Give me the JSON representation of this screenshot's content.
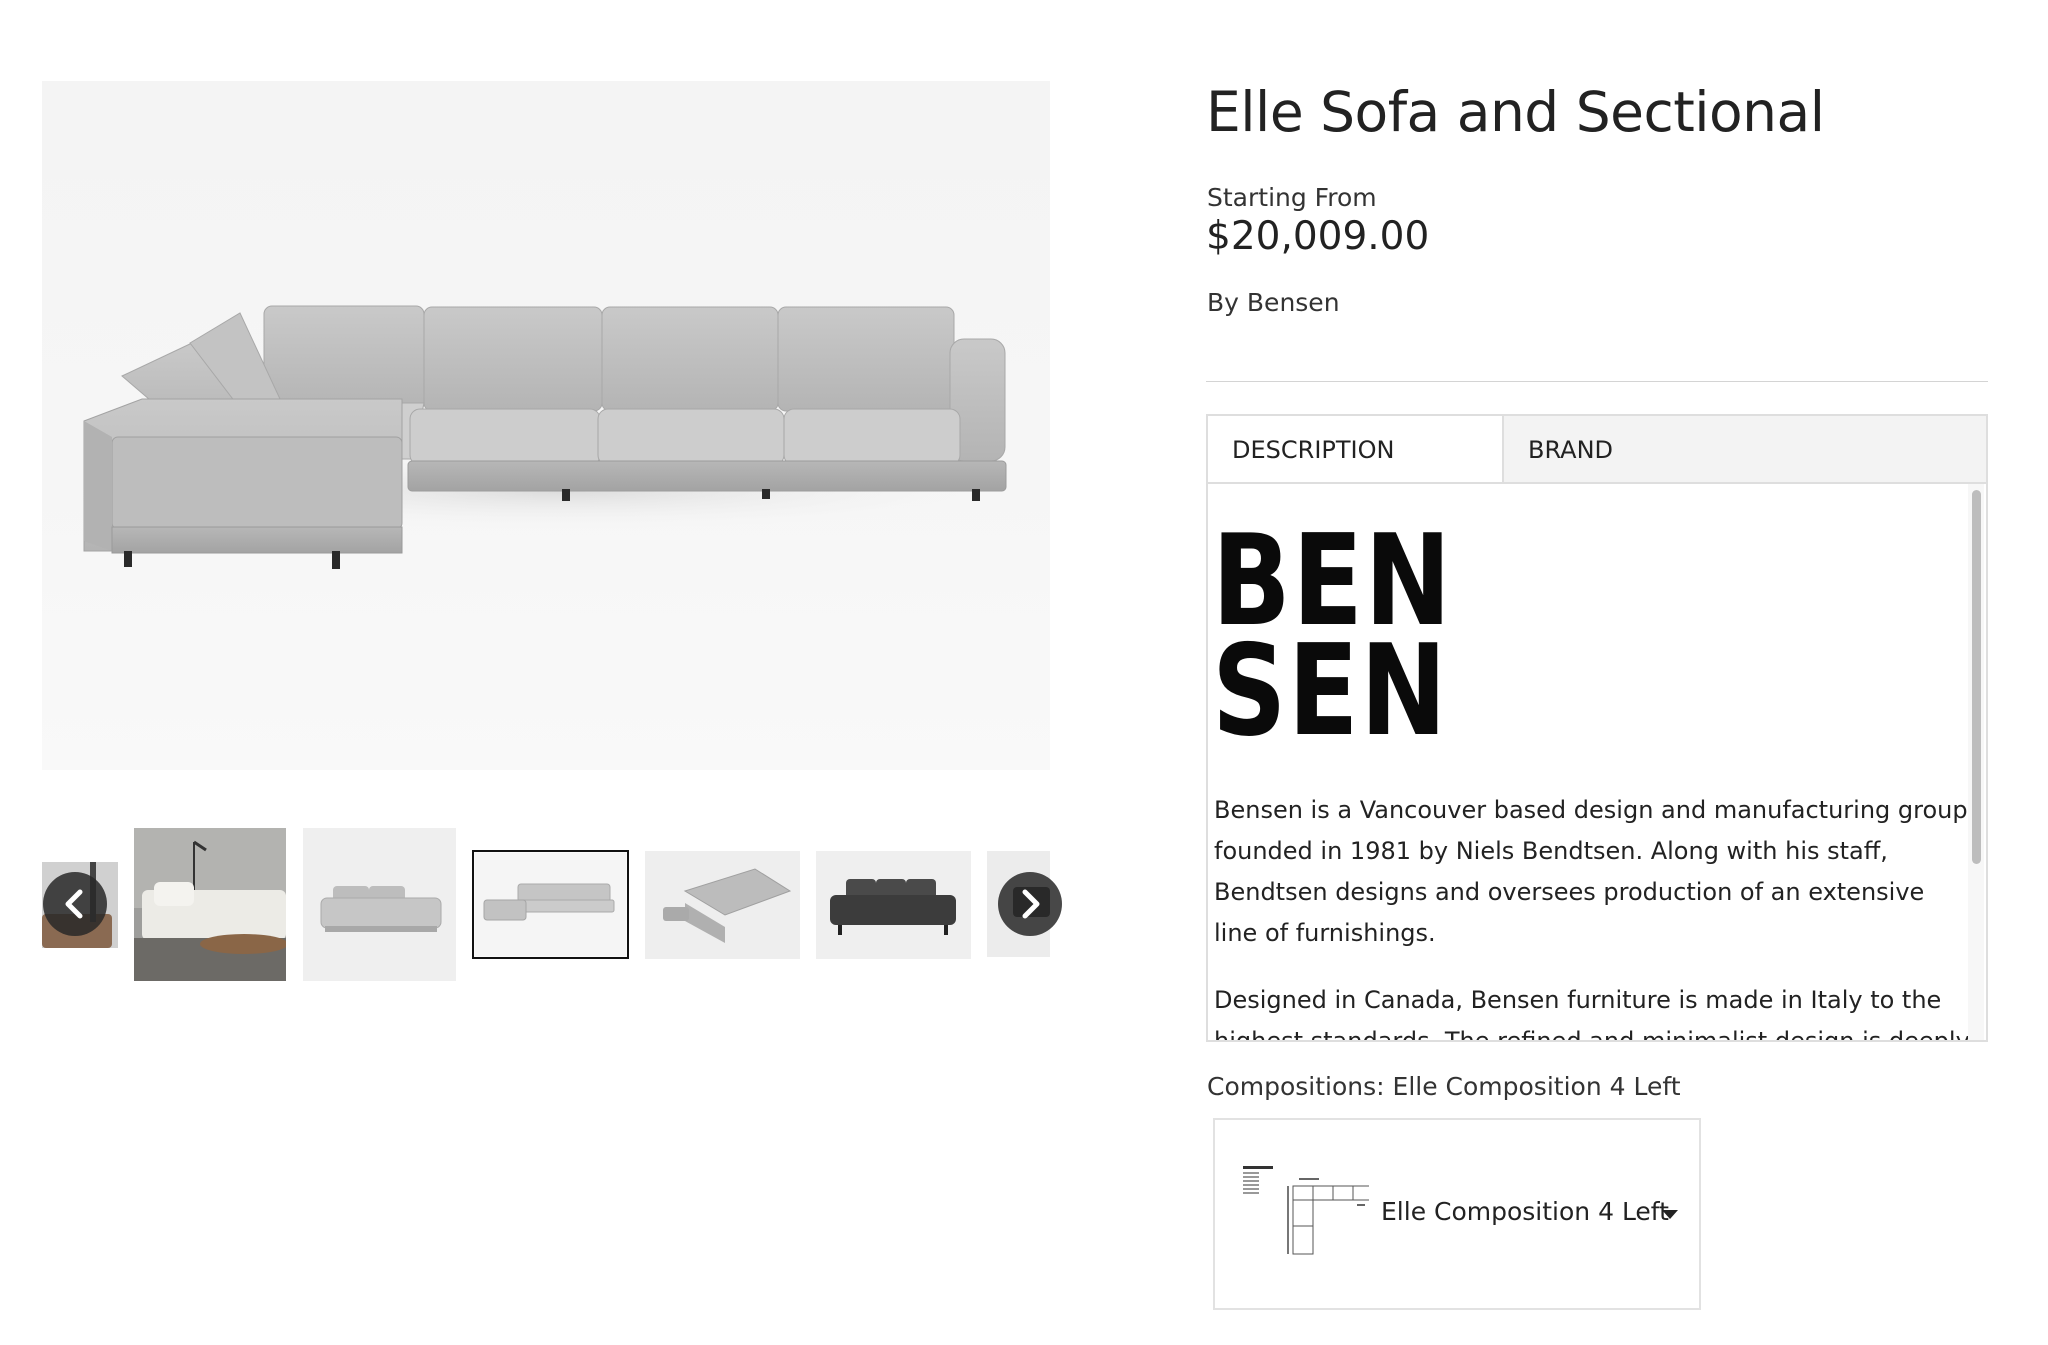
{
  "product": {
    "title": "Elle Sofa and Sectional",
    "price_prefix": "Starting From",
    "price": "$20,009.00",
    "by_prefix": "By",
    "brand": "Bensen"
  },
  "gallery": {
    "main_image": "sectional-sofa-photo",
    "thumbnails": [
      {
        "name": "partial-photo",
        "selected": false
      },
      {
        "name": "living-room-sectional-photo",
        "selected": false
      },
      {
        "name": "grey-sofa-photo",
        "selected": false
      },
      {
        "name": "l-sectional-photo",
        "selected": true
      },
      {
        "name": "sectional-with-ottoman-photo",
        "selected": false
      },
      {
        "name": "dark-grey-sofa-photo",
        "selected": false
      },
      {
        "name": "partial-dark-photo",
        "selected": false
      }
    ],
    "prev_icon": "chevron-left-icon",
    "next_icon": "chevron-right-icon"
  },
  "tabs": [
    {
      "label": "DESCRIPTION",
      "active": false
    },
    {
      "label": "BRAND",
      "active": true
    }
  ],
  "brand_panel": {
    "logo_line1": "BEN",
    "logo_line2": "SEN",
    "paragraphs": [
      "Bensen is a Vancouver based design and manufacturing group founded in 1981 by Niels Bendtsen. Along with his staff, Bendtsen designs and oversees production of an extensive line of furnishings.",
      "Designed in Canada, Bensen furniture is made in Italy to the highest standards. The refined and minimalist design is deeply"
    ]
  },
  "compositions": {
    "label": "Compositions: Elle Composition 4 Left",
    "selected": "Elle Composition 4 Left",
    "caret_icon": "caret-down-icon"
  },
  "colors": {
    "text": "#222222",
    "border": "#dedede",
    "inactive_tab_bg": "#f3f3f3",
    "nav_arrow_bg": "#282828"
  }
}
